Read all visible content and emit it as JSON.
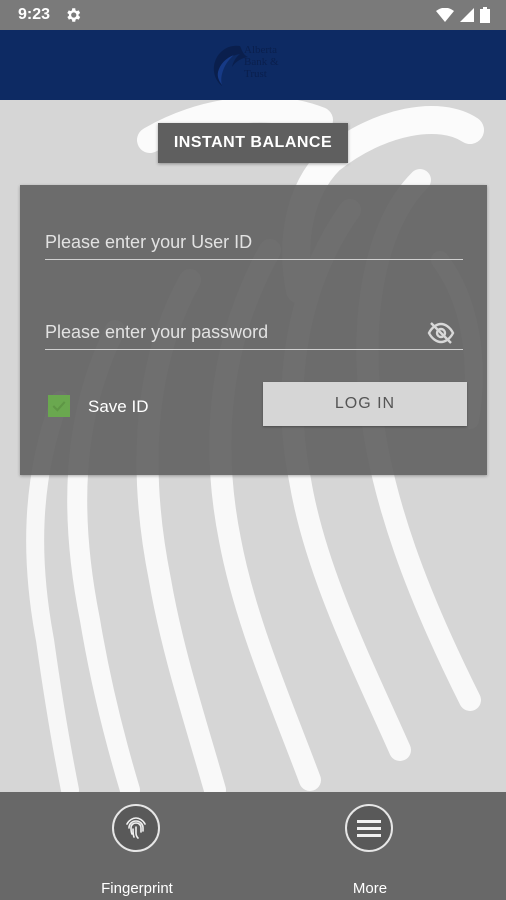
{
  "status_bar": {
    "time": "9:23"
  },
  "header": {
    "logo_lines": [
      "Alberta",
      "Bank &",
      "Trust"
    ]
  },
  "instant_balance": {
    "label": "INSTANT BALANCE"
  },
  "login": {
    "user_id_placeholder": "Please enter your User ID",
    "password_placeholder": "Please enter your password",
    "save_id_label": "Save ID",
    "save_id_checked": true,
    "login_label": "LOG IN"
  },
  "bottom_nav": [
    {
      "label": "Fingerprint",
      "icon": "fingerprint-icon"
    },
    {
      "label": "More",
      "icon": "menu-icon"
    }
  ],
  "colors": {
    "header": "#0d2a63",
    "checkbox": "#6aa84f",
    "status_bar": "#7a7a7a"
  }
}
